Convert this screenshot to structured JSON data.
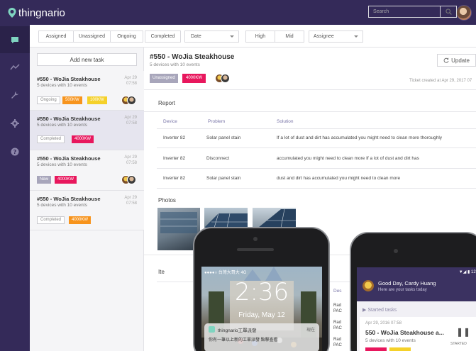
{
  "app": {
    "name": "thingnario"
  },
  "sidebar": {
    "items": [
      {
        "name": "chat-icon",
        "active": true
      },
      {
        "name": "trend-icon",
        "active": false
      },
      {
        "name": "wrench-icon",
        "active": false
      },
      {
        "name": "gear-icon",
        "active": false
      },
      {
        "name": "help-icon",
        "active": false
      }
    ]
  },
  "filters": {
    "assigned": "Assigned",
    "unassigned": "Unassigned",
    "ongoing": "Ongoing",
    "completed": "Completed",
    "date": "Date",
    "high": "High",
    "mid": "Mid",
    "assignee": "Assignee",
    "search_placeholder": "Search"
  },
  "tasklist": {
    "add_label": "Add new task",
    "cards": [
      {
        "title": "#550 - WoJia Steakhouse",
        "sub": "5 devices with 10 events",
        "date1": "Apr 29",
        "date2": "07:58",
        "tags": [
          "Ongoing",
          "500KW",
          "100KW"
        ]
      },
      {
        "title": "#550 - WoJia Steakhouse",
        "sub": "5 devices with 10 events",
        "date1": "Apr 29",
        "date2": "07:58",
        "tags": [
          "Completed",
          "4000KW"
        ]
      },
      {
        "title": "#550 - WoJia Steakhouse",
        "sub": "5 devices with 10 events",
        "date1": "Apr 29",
        "date2": "07:58",
        "tags": [
          "New",
          "4000KW"
        ]
      },
      {
        "title": "#550 - WoJia Steakhouse",
        "sub": "5 devices with 10 events",
        "date1": "Apr 29",
        "date2": "07:58",
        "tags": [
          "Completed",
          "4000KW"
        ]
      }
    ]
  },
  "detail": {
    "title": "#550 - WoJia Steakhouse",
    "sub": "5 devices with 10 events",
    "status_tag": "Unassigned",
    "power_tag": "4000KW",
    "update_label": "Update",
    "created": "Ticket created at Apr 29, 2017 07",
    "report_title": "Report",
    "headers": {
      "device": "Device",
      "problem": "Problem",
      "solution": "Solution"
    },
    "rows": [
      {
        "device": "Inverter 82",
        "problem": "Solar panel stain",
        "solution": "If a lot of dust and dirt has accumulated you might need to clean more thoroughly"
      },
      {
        "device": "Inverter 82",
        "problem": "Disconnect",
        "solution": "accumulated you might need to clean more If a lot of dust and dirt has"
      },
      {
        "device": "Inverter 82",
        "problem": "Solar panel stain",
        "solution": "dust and dirt has accumulated you might need to clean more"
      }
    ],
    "photos_title": "Photos",
    "items_title": "Ite",
    "des_label": "Des",
    "rad": [
      "Rad",
      "PAC",
      "Rad",
      "PAC",
      "Rad",
      "PAC",
      "Rad",
      "PAC"
    ]
  },
  "lockscreen": {
    "carrier": "●●●●○ 台灣大哥大 4G",
    "time": "2:36",
    "date": "Friday, May 12",
    "notif_app": "thingnario工單派發",
    "notif_time": "現在",
    "notif_body": "你有一筆以上新的工單派發 點擊查看"
  },
  "appscreen": {
    "greeting": "Good Day, Cardy Huang",
    "subtitle": "Here are your tasks today",
    "started": "Started tasks",
    "date": "Apr 29, 2016 07:58",
    "title": "550 - WoJia Steakhouse a...",
    "sub": "5 devices with 10 events",
    "started_label": "STARTED"
  },
  "colors": {
    "nav": "#342a59",
    "red": "#e8175d",
    "orange": "#f7941d",
    "yellow": "#f5d12a"
  }
}
